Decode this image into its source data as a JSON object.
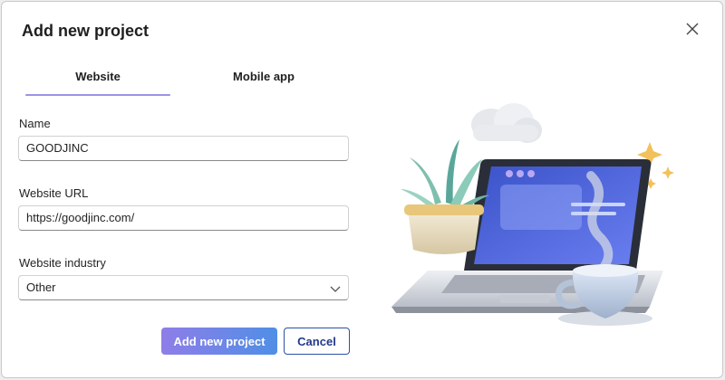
{
  "dialog": {
    "title": "Add new project"
  },
  "tabs": [
    {
      "label": "Website",
      "active": true
    },
    {
      "label": "Mobile app",
      "active": false
    }
  ],
  "form": {
    "name": {
      "label": "Name",
      "value": "GOODJINC"
    },
    "url": {
      "label": "Website URL",
      "value": "https://goodjinc.com/"
    },
    "industry": {
      "label": "Website industry",
      "value": "Other"
    }
  },
  "buttons": {
    "primary": "Add new project",
    "secondary": "Cancel"
  },
  "colors": {
    "accent": "#9a93e6",
    "primary_gradient_start": "#8f7de8",
    "primary_gradient_end": "#4f8fe6",
    "secondary_border": "#2b4fa8"
  },
  "icons": {
    "close": "close-icon",
    "dropdown": "chevron-down-icon"
  }
}
